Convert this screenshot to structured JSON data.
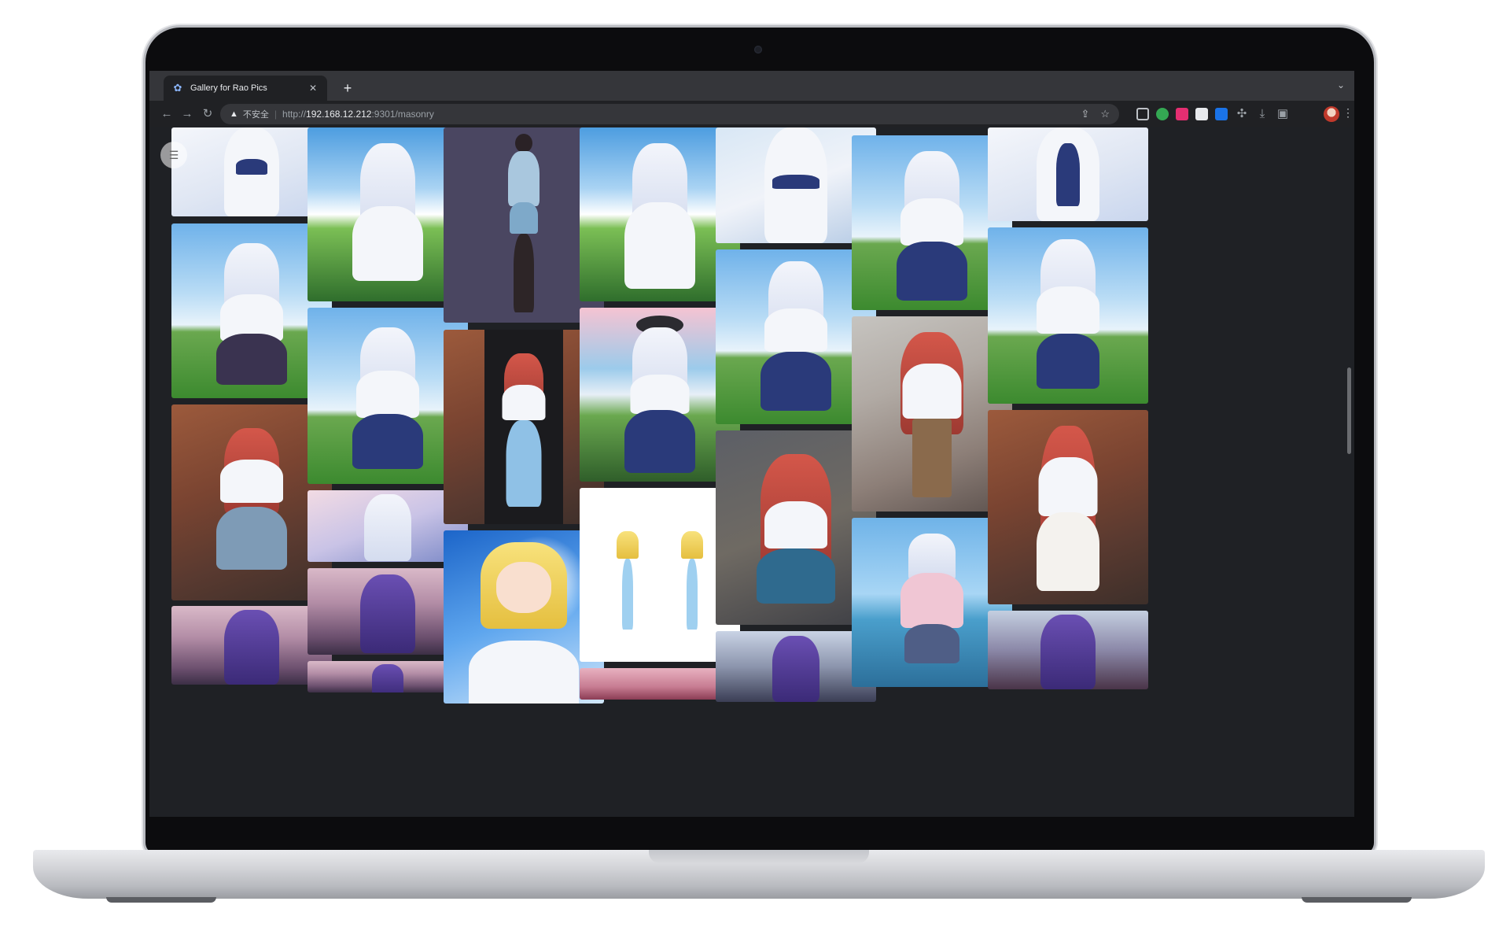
{
  "browser": {
    "tab_title": "Gallery for Rao Pics",
    "new_tab_label": "+",
    "security_label": "不安全",
    "url_scheme": "http://",
    "url_host": "192.168.12.212",
    "url_rest": ":9301/masonry"
  },
  "icons": {
    "favicon": "rao-pics-icon",
    "back": "arrow-left-icon",
    "forward": "arrow-right-icon",
    "reload": "reload-icon",
    "warning": "warning-icon",
    "share": "share-icon",
    "bookmark": "star-icon",
    "extensions": "puzzle-icon",
    "download": "download-icon",
    "sidepanel": "side-panel-icon",
    "menu": "kebab-icon",
    "gallery_menu": "hamburger-icon"
  },
  "colors": {
    "chrome_dark": "#202124",
    "tab_strip": "#35363a",
    "page_bg": "#1f2125",
    "accent": "#8ab4f8"
  },
  "gallery": {
    "layout": "masonry",
    "columns": [
      {
        "images": [
          "white-hair-girl",
          "white-hair-girl-mountain",
          "red-hair-girl-wall",
          "purple-hair-girl-room"
        ]
      },
      {
        "images": [
          "white-hair-girl-flowers",
          "white-hair-girl-mountain",
          "white-hair-girl-petals",
          "purple-hair-girl-room",
          "purple-hair-girl"
        ]
      },
      {
        "images": [
          "girl-3d-model",
          "red-hair-girl-alley",
          "blonde-girl-beach"
        ]
      },
      {
        "images": [
          "white-hair-girl-coast",
          "white-hair-girl-blossom",
          "blonde-girls-stretch",
          "pink-scene"
        ]
      },
      {
        "images": [
          "white-hair-girl-dress",
          "white-hair-girl-mountain",
          "red-hair-girl-wall",
          "purple-hair-girl-street"
        ]
      },
      {
        "images": [
          "white-hair-girl-tree",
          "red-hair-girl-graffiti",
          "silver-hair-girl-lake"
        ]
      },
      {
        "images": [
          "white-hair-girl-flowers",
          "white-hair-girl-tree",
          "red-hair-girl-brick",
          "purple-hair-girl-room"
        ]
      }
    ]
  }
}
